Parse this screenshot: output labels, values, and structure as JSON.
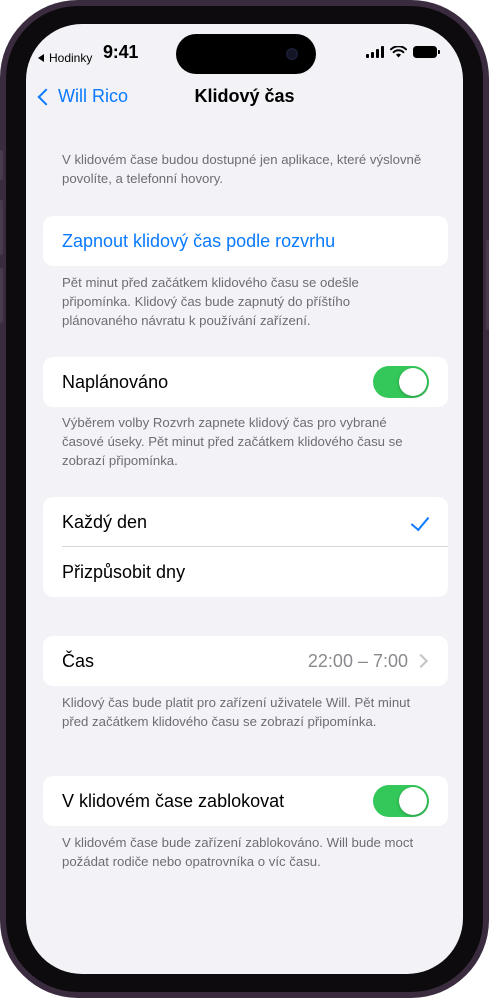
{
  "status_bar": {
    "carrier_back": "Hodinky",
    "time": "9:41"
  },
  "nav": {
    "back_label": "Will Rico",
    "title": "Klidový čas"
  },
  "intro_text": "V klidovém čase budou dostupné jen aplikace, které výslovně povolíte, a telefonní hovory.",
  "schedule_link": {
    "label": "Zapnout klidový čas podle rozvrhu",
    "footnote": "Pět minut před začátkem klidového času se odešle připomínka. Klidový čas bude zapnutý do příštího plánovaného návratu k používání zařízení."
  },
  "scheduled": {
    "label": "Naplánováno",
    "on": true,
    "footnote": "Výběrem volby Rozvrh zapnete klidový čas pro vybrané časové úseky. Pět minut před začátkem klidového času se zobrazí připomínka."
  },
  "days": {
    "options": [
      {
        "label": "Každý den",
        "selected": true
      },
      {
        "label": "Přizpůsobit dny",
        "selected": false
      }
    ]
  },
  "time_row": {
    "label": "Čas",
    "value": "22:00 – 7:00",
    "footnote": "Klidový čas bude platit pro zařízení uživatele Will. Pět minut před začátkem klidového času se zobrazí připomínka."
  },
  "block": {
    "label": "V klidovém čase zablokovat",
    "on": true,
    "footnote": "V klidovém čase bude zařízení zablokováno. Will bude moct požádat rodiče nebo opatro­vníka o víc času."
  },
  "colors": {
    "accent": "#0a7aff",
    "toggle_on": "#34c759",
    "background": "#f2f2f7",
    "frame": "#3a2c3e"
  },
  "icons": [
    "back-triangle-icon",
    "chevron-left-icon",
    "signal-icon",
    "wifi-icon",
    "battery-icon",
    "checkmark-icon",
    "chevron-right-icon"
  ]
}
